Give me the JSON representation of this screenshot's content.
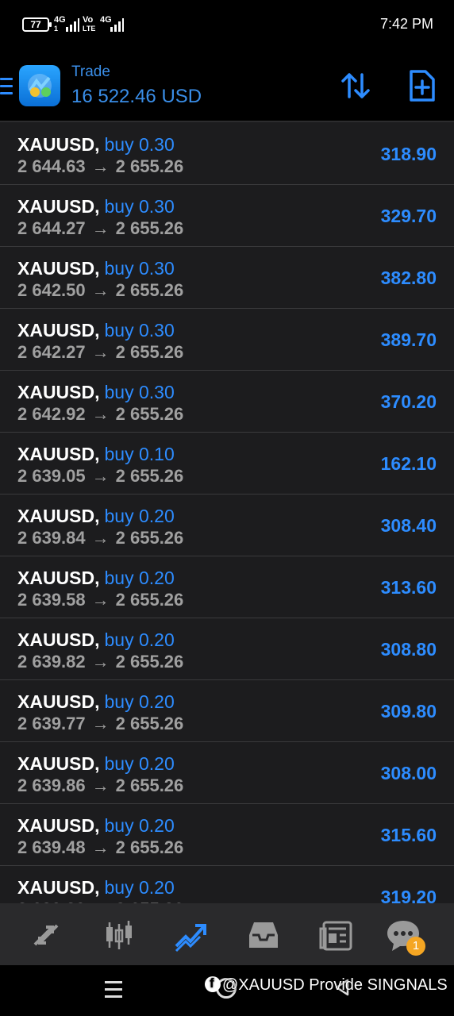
{
  "status_bar": {
    "battery": "77",
    "net1_top": "4G",
    "net1_bottom": "1",
    "volte_top": "Vo",
    "volte_bottom": "LTE",
    "net2": "4G",
    "time": "7:42 PM"
  },
  "header": {
    "title": "Trade",
    "balance": "16 522.46 USD"
  },
  "positions": [
    {
      "symbol": "XAUUSD",
      "side": "buy 0.30",
      "open": "2 644.63",
      "current": "2 655.26",
      "profit": "318.90"
    },
    {
      "symbol": "XAUUSD",
      "side": "buy 0.30",
      "open": "2 644.27",
      "current": "2 655.26",
      "profit": "329.70"
    },
    {
      "symbol": "XAUUSD",
      "side": "buy 0.30",
      "open": "2 642.50",
      "current": "2 655.26",
      "profit": "382.80"
    },
    {
      "symbol": "XAUUSD",
      "side": "buy 0.30",
      "open": "2 642.27",
      "current": "2 655.26",
      "profit": "389.70"
    },
    {
      "symbol": "XAUUSD",
      "side": "buy 0.30",
      "open": "2 642.92",
      "current": "2 655.26",
      "profit": "370.20"
    },
    {
      "symbol": "XAUUSD",
      "side": "buy 0.10",
      "open": "2 639.05",
      "current": "2 655.26",
      "profit": "162.10"
    },
    {
      "symbol": "XAUUSD",
      "side": "buy 0.20",
      "open": "2 639.84",
      "current": "2 655.26",
      "profit": "308.40"
    },
    {
      "symbol": "XAUUSD",
      "side": "buy 0.20",
      "open": "2 639.58",
      "current": "2 655.26",
      "profit": "313.60"
    },
    {
      "symbol": "XAUUSD",
      "side": "buy 0.20",
      "open": "2 639.82",
      "current": "2 655.26",
      "profit": "308.80"
    },
    {
      "symbol": "XAUUSD",
      "side": "buy 0.20",
      "open": "2 639.77",
      "current": "2 655.26",
      "profit": "309.80"
    },
    {
      "symbol": "XAUUSD",
      "side": "buy 0.20",
      "open": "2 639.86",
      "current": "2 655.26",
      "profit": "308.00"
    },
    {
      "symbol": "XAUUSD",
      "side": "buy 0.20",
      "open": "2 639.48",
      "current": "2 655.26",
      "profit": "315.60"
    },
    {
      "symbol": "XAUUSD",
      "side": "buy 0.20",
      "open": "2 639.39",
      "current": "2 655.26",
      "profit": "319.20"
    }
  ],
  "row_separator": ",",
  "arrow_glyph": "→",
  "bottom_nav": {
    "items": [
      "quotes-icon",
      "chart-icon",
      "trade-icon",
      "history-icon",
      "news-icon",
      "messages-icon"
    ],
    "messages_badge": "1"
  },
  "watermark": "@XAUUSD Provide SINGNALS",
  "colors": {
    "accent": "#2d8cff",
    "background": "#1c1c1e",
    "secondary_text": "#a0a0a0",
    "badge": "#f5a623"
  }
}
